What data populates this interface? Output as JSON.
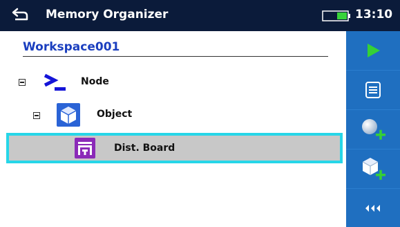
{
  "header": {
    "title": "Memory Organizer",
    "time": "13:10",
    "back_icon": "back-arrow-icon",
    "battery_icon": "battery-icon"
  },
  "workspace": {
    "name": "Workspace001"
  },
  "tree": {
    "node": {
      "label": "Node",
      "icon": "terminal-prompt-icon"
    },
    "object": {
      "label": "Object",
      "icon": "cube-icon"
    },
    "dist_board": {
      "label": "Dist. Board",
      "icon": "distribution-board-icon"
    }
  },
  "sidebar": {
    "buttons": [
      {
        "name": "play",
        "icon": "play-icon"
      },
      {
        "name": "list",
        "icon": "list-icon"
      },
      {
        "name": "add-structure",
        "icon": "add-sphere-icon"
      },
      {
        "name": "add-object",
        "icon": "add-cube-icon"
      },
      {
        "name": "more",
        "icon": "triple-arrow-left-icon"
      }
    ]
  },
  "colors": {
    "header_bg": "#0b1b3a",
    "sidebar_bg": "#1f6fc0",
    "selection_border": "#26d6e8",
    "selection_bg": "#c8c8c8",
    "workspace_text": "#1b3fbf"
  }
}
